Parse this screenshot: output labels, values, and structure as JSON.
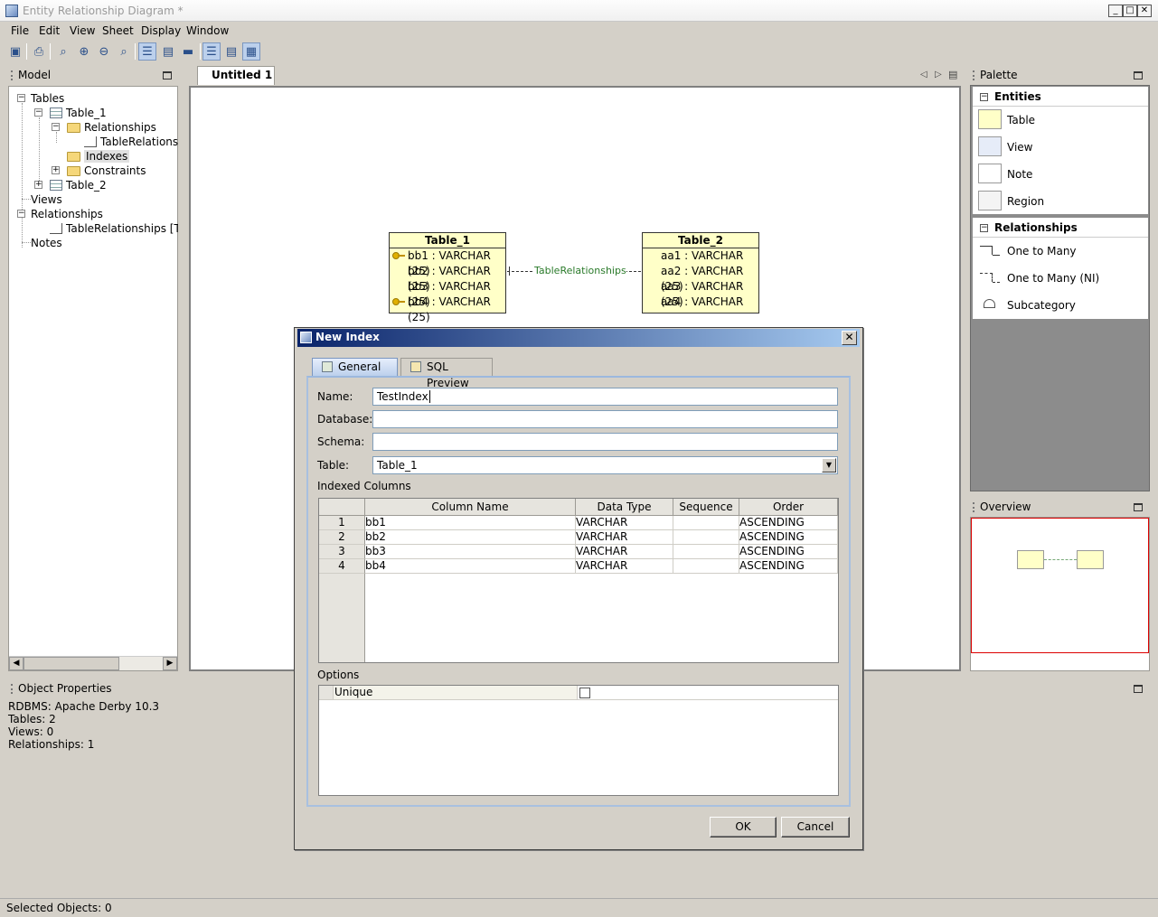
{
  "window": {
    "title": "Entity Relationship Diagram *",
    "min": "_",
    "max": "□",
    "close": "✕"
  },
  "menu": [
    "File",
    "Edit",
    "View",
    "Sheet",
    "Display",
    "Window"
  ],
  "model_panel": {
    "title": "Model",
    "tree": {
      "tables": "Tables",
      "table1": "Table_1",
      "relationships": "Relationships",
      "table_relationships": "TableRelationships",
      "indexes": "Indexes",
      "constraints": "Constraints",
      "table2": "Table_2",
      "views": "Views",
      "relationships_root": "Relationships",
      "table_relationships_full": "TableRelationships [Table_",
      "notes": "Notes"
    }
  },
  "editor": {
    "tab": "Untitled 1"
  },
  "diagram": {
    "table1": {
      "name": "Table_1",
      "columns": [
        "bb1 : VARCHAR (25)",
        "bb2 : VARCHAR (25)",
        "bb3 : VARCHAR (25)",
        "bb4 : VARCHAR (25)"
      ]
    },
    "table2": {
      "name": "Table_2",
      "columns": [
        "aa1 : VARCHAR",
        "aa2 : VARCHAR (25)",
        "aa3 : VARCHAR (25)",
        "aa4 : VARCHAR"
      ]
    },
    "relationship_label": "TableRelationships"
  },
  "palette": {
    "title": "Palette",
    "entities_header": "Entities",
    "entities": [
      "Table",
      "View",
      "Note",
      "Region"
    ],
    "relationships_header": "Relationships",
    "relationships": [
      "One to Many",
      "One to Many (NI)",
      "Subcategory"
    ]
  },
  "overview": {
    "title": "Overview"
  },
  "properties": {
    "title": "Object Properties",
    "lines": [
      "RDBMS: Apache Derby 10.3",
      "Tables: 2",
      "Views: 0",
      "Relationships: 1"
    ]
  },
  "status": "Selected Objects: 0",
  "dialog": {
    "title": "New Index",
    "tabs": [
      "General",
      "SQL Preview"
    ],
    "name_label": "Name:",
    "name_value": "TestIndex",
    "database_label": "Database:",
    "database_value": "",
    "schema_label": "Schema:",
    "schema_value": "",
    "table_label": "Table:",
    "table_value": "Table_1",
    "indexed_columns_label": "Indexed Columns",
    "columns_header": [
      "Column Name",
      "Data Type",
      "Sequence",
      "Order"
    ],
    "rows": [
      {
        "n": "1",
        "name": "bb1",
        "type": "VARCHAR",
        "seq": "",
        "order": "ASCENDING"
      },
      {
        "n": "2",
        "name": "bb2",
        "type": "VARCHAR",
        "seq": "",
        "order": "ASCENDING"
      },
      {
        "n": "3",
        "name": "bb3",
        "type": "VARCHAR",
        "seq": "",
        "order": "ASCENDING"
      },
      {
        "n": "4",
        "name": "bb4",
        "type": "VARCHAR",
        "seq": "",
        "order": "ASCENDING"
      }
    ],
    "options_label": "Options",
    "unique_label": "Unique",
    "unique_checked": false,
    "ok": "OK",
    "cancel": "Cancel"
  }
}
